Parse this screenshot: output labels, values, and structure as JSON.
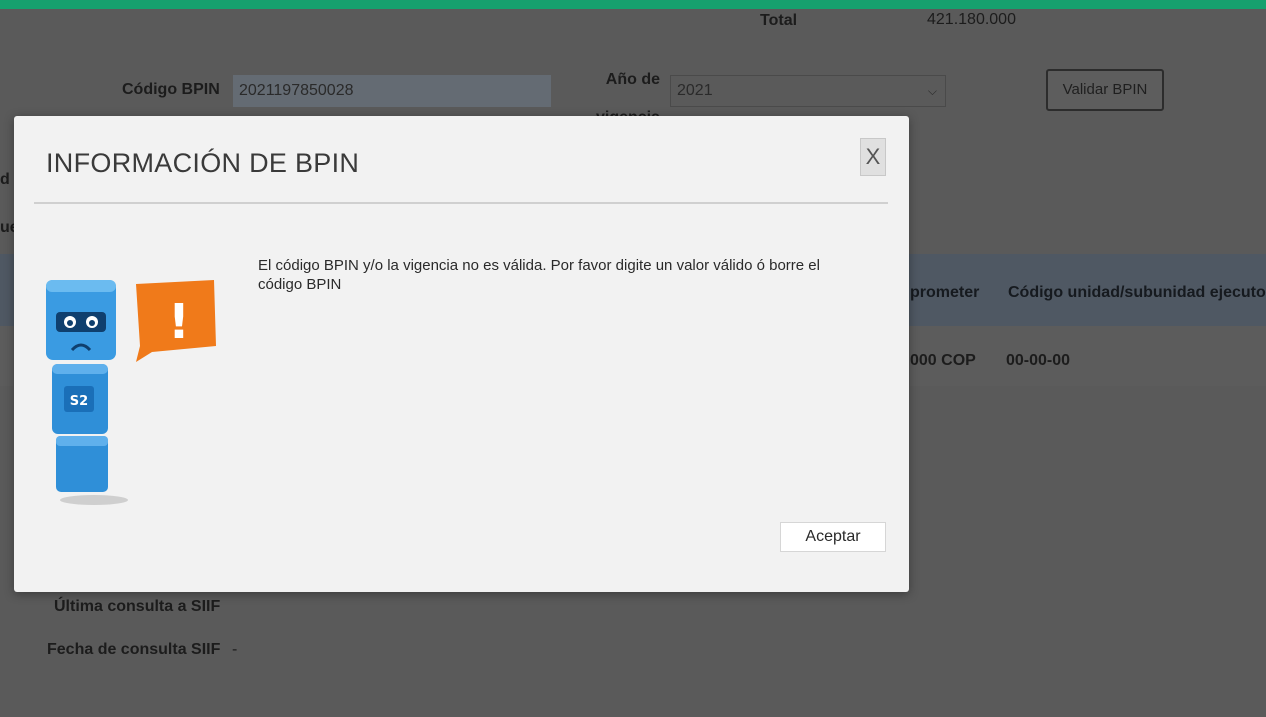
{
  "header": {
    "total_label": "Total",
    "total_value": "421.180.000"
  },
  "form": {
    "bpin_label": "Código BPIN",
    "bpin_value": "2021197850028",
    "year_label_line1": "Año de",
    "year_label_line2": "vigencia",
    "year_value": "2021",
    "validate_button": "Validar BPIN"
  },
  "background": {
    "fragment_1": "d",
    "fragment_2": "ue",
    "col_comprometer": "prometer",
    "col_codigo": "Código unidad/subunidad ejecutor",
    "cell_cop": "000 COP",
    "cell_code": "00-00-00",
    "last_siif_label": "Última consulta a SIIF",
    "fecha_siif_label": "Fecha de consulta SIIF",
    "fecha_siif_value": "-"
  },
  "modal": {
    "title": "INFORMACIÓN DE BPIN",
    "close_label": "X",
    "message": "El código BPIN y/o la vigencia no es válida. Por favor digite un valor válido ó borre el código BPIN",
    "accept_button": "Aceptar",
    "mascot_badge": "S2",
    "mascot_alert": "!"
  },
  "colors": {
    "topbar": "#16a06e",
    "overlay": "#5a5a5a",
    "modal_bg": "#f2f2f2",
    "mascot_blue": "#2f8fd8",
    "alert_orange": "#f07a1a"
  }
}
